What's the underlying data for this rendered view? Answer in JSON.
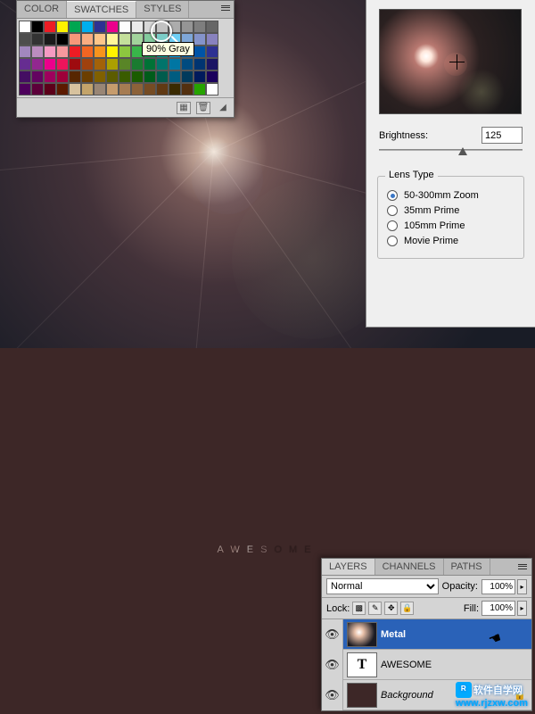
{
  "swatches": {
    "tabs": [
      "COLOR",
      "SWATCHES",
      "STYLES"
    ],
    "active": 1,
    "tooltip": "90% Gray",
    "colors": [
      "#ffffff",
      "#000000",
      "#ed1c24",
      "#fff200",
      "#00a651",
      "#00aeef",
      "#2e3192",
      "#ec008c",
      "#fdfdfd",
      "#ebebeb",
      "#d7d7d7",
      "#c2c2c2",
      "#acacac",
      "#959595",
      "#7e7e7e",
      "#666666",
      "#4d4d4d",
      "#333333",
      "#1a1a1a",
      "#000000",
      "#f7977a",
      "#f9ad81",
      "#fdc68a",
      "#fff79a",
      "#c4df9b",
      "#a2d39c",
      "#82ca9d",
      "#7bcdc8",
      "#6ecff6",
      "#7ea7d8",
      "#8493ca",
      "#8882be",
      "#a187be",
      "#bc8dbf",
      "#f49ac2",
      "#f6989d",
      "#ed1c24",
      "#f26522",
      "#f7941d",
      "#fff200",
      "#8dc73f",
      "#39b54a",
      "#00a651",
      "#00a99d",
      "#00aeef",
      "#0072bc",
      "#0054a6",
      "#2e3192",
      "#662d91",
      "#92278f",
      "#ec008c",
      "#ed145b",
      "#9e0b0f",
      "#a0410d",
      "#a36209",
      "#aba000",
      "#598527",
      "#1a7b30",
      "#007236",
      "#00746b",
      "#0076a3",
      "#004b80",
      "#003471",
      "#1b1464",
      "#440e62",
      "#630460",
      "#9e005d",
      "#9e0039",
      "#572600",
      "#6b3e00",
      "#806000",
      "#5c5c00",
      "#3a5c00",
      "#1a5c00",
      "#005c1a",
      "#005c4d",
      "#005c80",
      "#003a5c",
      "#001a5c",
      "#1a005c",
      "#4d005c",
      "#5c003a",
      "#5c001a",
      "#5c1a00",
      "#d7c29e",
      "#c4a46a",
      "#998675",
      "#c69c6d",
      "#a67c52",
      "#8c6239",
      "#754c24",
      "#603913",
      "#3a2a00",
      "#53300f",
      "#26a300",
      "#ffffff"
    ]
  },
  "lens": {
    "brightness_label": "Brightness:",
    "brightness_value": "125",
    "group_title": "Lens Type",
    "options": [
      "50-300mm Zoom",
      "35mm Prime",
      "105mm Prime",
      "Movie Prime"
    ],
    "selected": 0
  },
  "layers": {
    "tabs": [
      "LAYERS",
      "CHANNELS",
      "PATHS"
    ],
    "blend_mode": "Normal",
    "opacity_label": "Opacity:",
    "opacity_value": "100%",
    "lock_label": "Lock:",
    "fill_label": "Fill:",
    "fill_value": "100%",
    "items": [
      {
        "name": "Metal",
        "type": "image",
        "selected": true
      },
      {
        "name": "AWESOME",
        "type": "text",
        "selected": false
      },
      {
        "name": "Background",
        "type": "bg",
        "selected": false,
        "locked": true
      }
    ]
  },
  "artwork_text": "AWESOME",
  "watermark": {
    "brand": "软件自学网",
    "url": "www.rjzxw.com"
  }
}
